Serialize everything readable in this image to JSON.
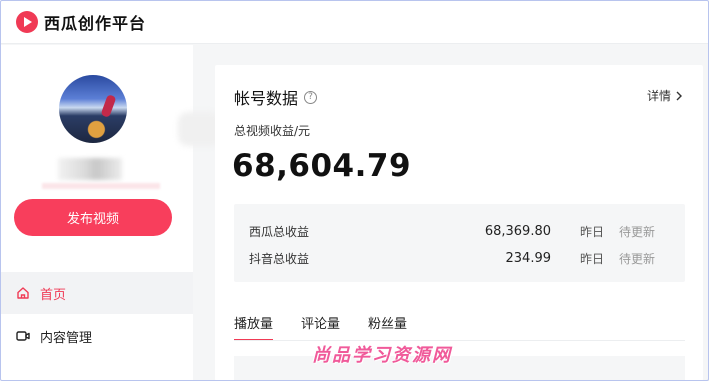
{
  "app": {
    "name": "西瓜创作平台"
  },
  "sidebar": {
    "publish_label": "发布视频",
    "items": [
      {
        "label": "首页",
        "icon": "home-icon",
        "active": true
      },
      {
        "label": "内容管理",
        "icon": "video-icon",
        "active": false
      }
    ]
  },
  "account": {
    "title": "帐号数据",
    "detail_label": "详情",
    "metric_label": "总视频收益/元",
    "metric_value": "68,604.79",
    "breakdown": [
      {
        "name": "西瓜总收益",
        "value": "68,369.80",
        "day": "昨日",
        "status": "待更新"
      },
      {
        "name": "抖音总收益",
        "value": "234.99",
        "day": "昨日",
        "status": "待更新"
      }
    ],
    "tabs": [
      "播放量",
      "评论量",
      "粉丝量"
    ]
  },
  "watermark": "尚品学习资源网",
  "colors": {
    "brand": "#f03a55",
    "button": "#f83e5c"
  }
}
